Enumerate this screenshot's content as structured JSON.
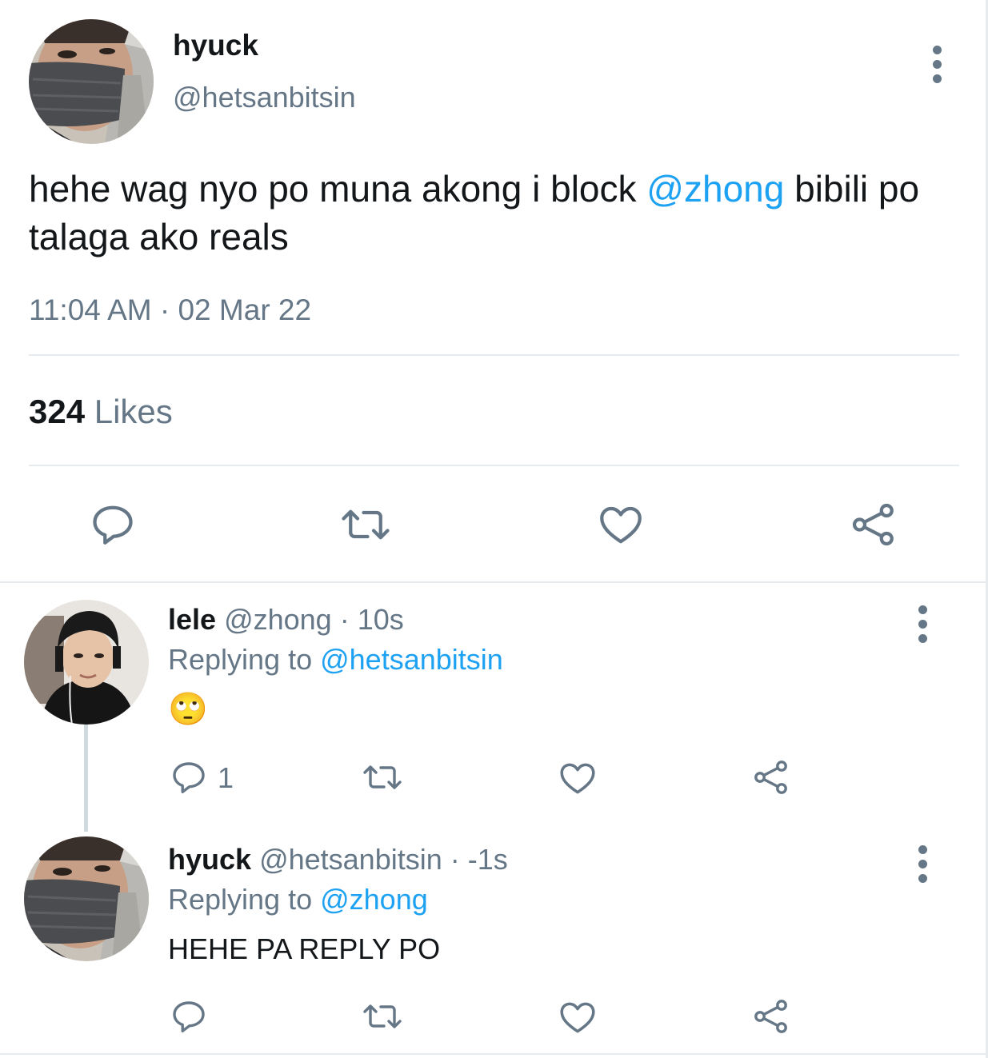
{
  "main_tweet": {
    "name": "hyuck",
    "handle": "@hetsanbitsin",
    "text_before": "hehe wag nyo po muna akong i block ",
    "mention": "@zhong",
    "text_after": " bibili po talaga ako reals",
    "time": "11:04 AM",
    "separator": " · ",
    "date": "02 Mar 22",
    "likes_count": "324",
    "likes_label": " Likes",
    "actions": [
      "reply-icon",
      "retweet-icon",
      "like-icon",
      "share-icon"
    ]
  },
  "replies": [
    {
      "name": "lele",
      "handle": "@zhong",
      "time": "· 10s",
      "replying_label": "Replying to ",
      "replying_to": "@hetsanbitsin",
      "text": "🙄",
      "reply_count": "1"
    },
    {
      "name": "hyuck",
      "handle": "@hetsanbitsin",
      "time": "· -1s",
      "replying_label": "Replying to ",
      "replying_to": "@zhong",
      "text": "HEHE PA REPLY PO"
    }
  ],
  "colors": {
    "accent": "#1da1f2",
    "text": "#14171a",
    "muted": "#657786",
    "divider": "#e6ecf0"
  }
}
